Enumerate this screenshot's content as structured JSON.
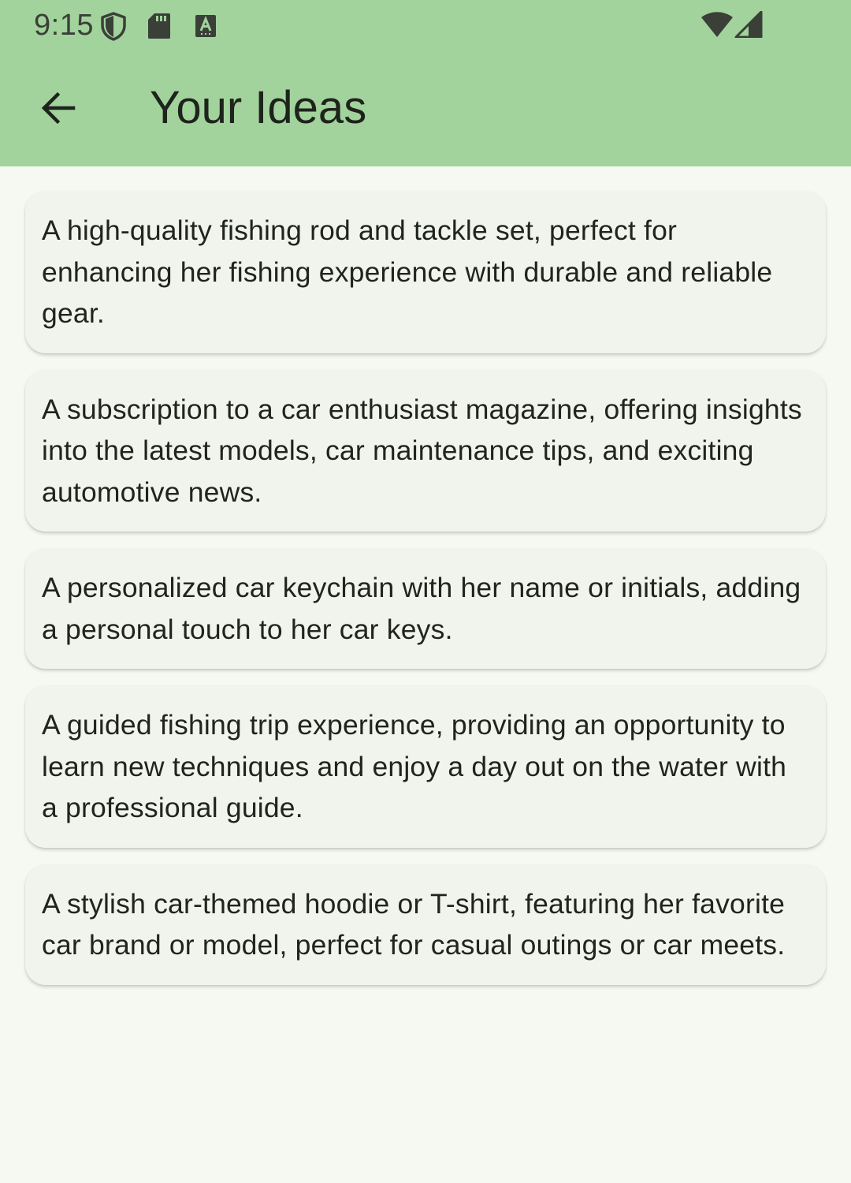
{
  "status_bar": {
    "time": "9:15",
    "icons": [
      "shield-icon",
      "sd-card-icon",
      "keyboard-a-icon",
      "wifi-icon",
      "signal-icon"
    ]
  },
  "app_bar": {
    "back_icon": "arrow-left-icon",
    "title": "Your Ideas"
  },
  "ideas": [
    "A high-quality fishing rod and tackle set, perfect for enhancing her fishing experience with durable and reliable gear.",
    "A subscription to a car enthusiast magazine, offering insights into the latest models, car maintenance tips, and exciting automotive news.",
    "A personalized car keychain with her name or initials, adding a personal touch to her car keys.",
    "A guided fishing trip experience, providing an opportunity to learn new techniques and enjoy a day out on the water with a professional guide.",
    "A stylish car-themed hoodie or T-shirt, featuring her favorite car brand or model, perfect for casual outings or car meets."
  ],
  "colors": {
    "app_bar_background": "#A2D39C",
    "page_background": "#F6F9F1",
    "card_background": "#F1F4EC"
  }
}
